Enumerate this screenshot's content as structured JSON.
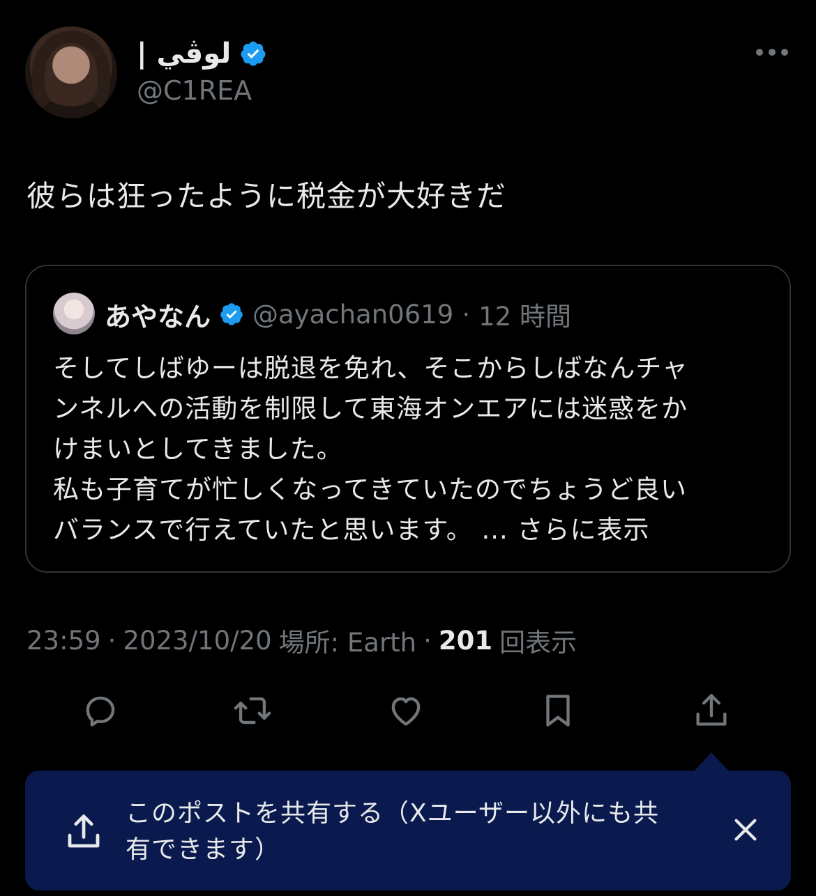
{
  "author": {
    "display_name": "لوڤي |",
    "handle": "@C1REA"
  },
  "post": {
    "text": "彼らは狂ったように税金が大好きだ"
  },
  "quote": {
    "name": "あやなん",
    "handle": "@ayachan0619",
    "separator": "·",
    "time": "12 時間",
    "lines": [
      "そしてしばゆーは脱退を免れ、そこからしばなんチャ",
      "ンネルへの活動を制限して東海オンエアには迷惑をか",
      "けまいとしてきました。",
      "私も子育てが忙しくなってきていたのでちょうど良い",
      "バランスで行えていたと思います。"
    ],
    "ellipsis": "...",
    "show_more": "さらに表示"
  },
  "meta": {
    "time": "23:59",
    "dot1": "·",
    "date": "2023/10/20",
    "location_label": "場所: Earth",
    "dot2": "·",
    "views": "201",
    "views_label": "回表示"
  },
  "actions": {
    "icons": [
      "reply-icon",
      "repost-icon",
      "like-icon",
      "bookmark-icon",
      "share-icon"
    ]
  },
  "share_prompt": {
    "text_line1": "このポストを共有する（Xユーザー以外にも共",
    "text_line2": "有できます）"
  },
  "colors": {
    "background": "#000000",
    "text_primary": "#e7e9ea",
    "text_secondary": "#71767b",
    "verified": "#1d9bf0",
    "prompt_bg": "#0a1a4f"
  }
}
